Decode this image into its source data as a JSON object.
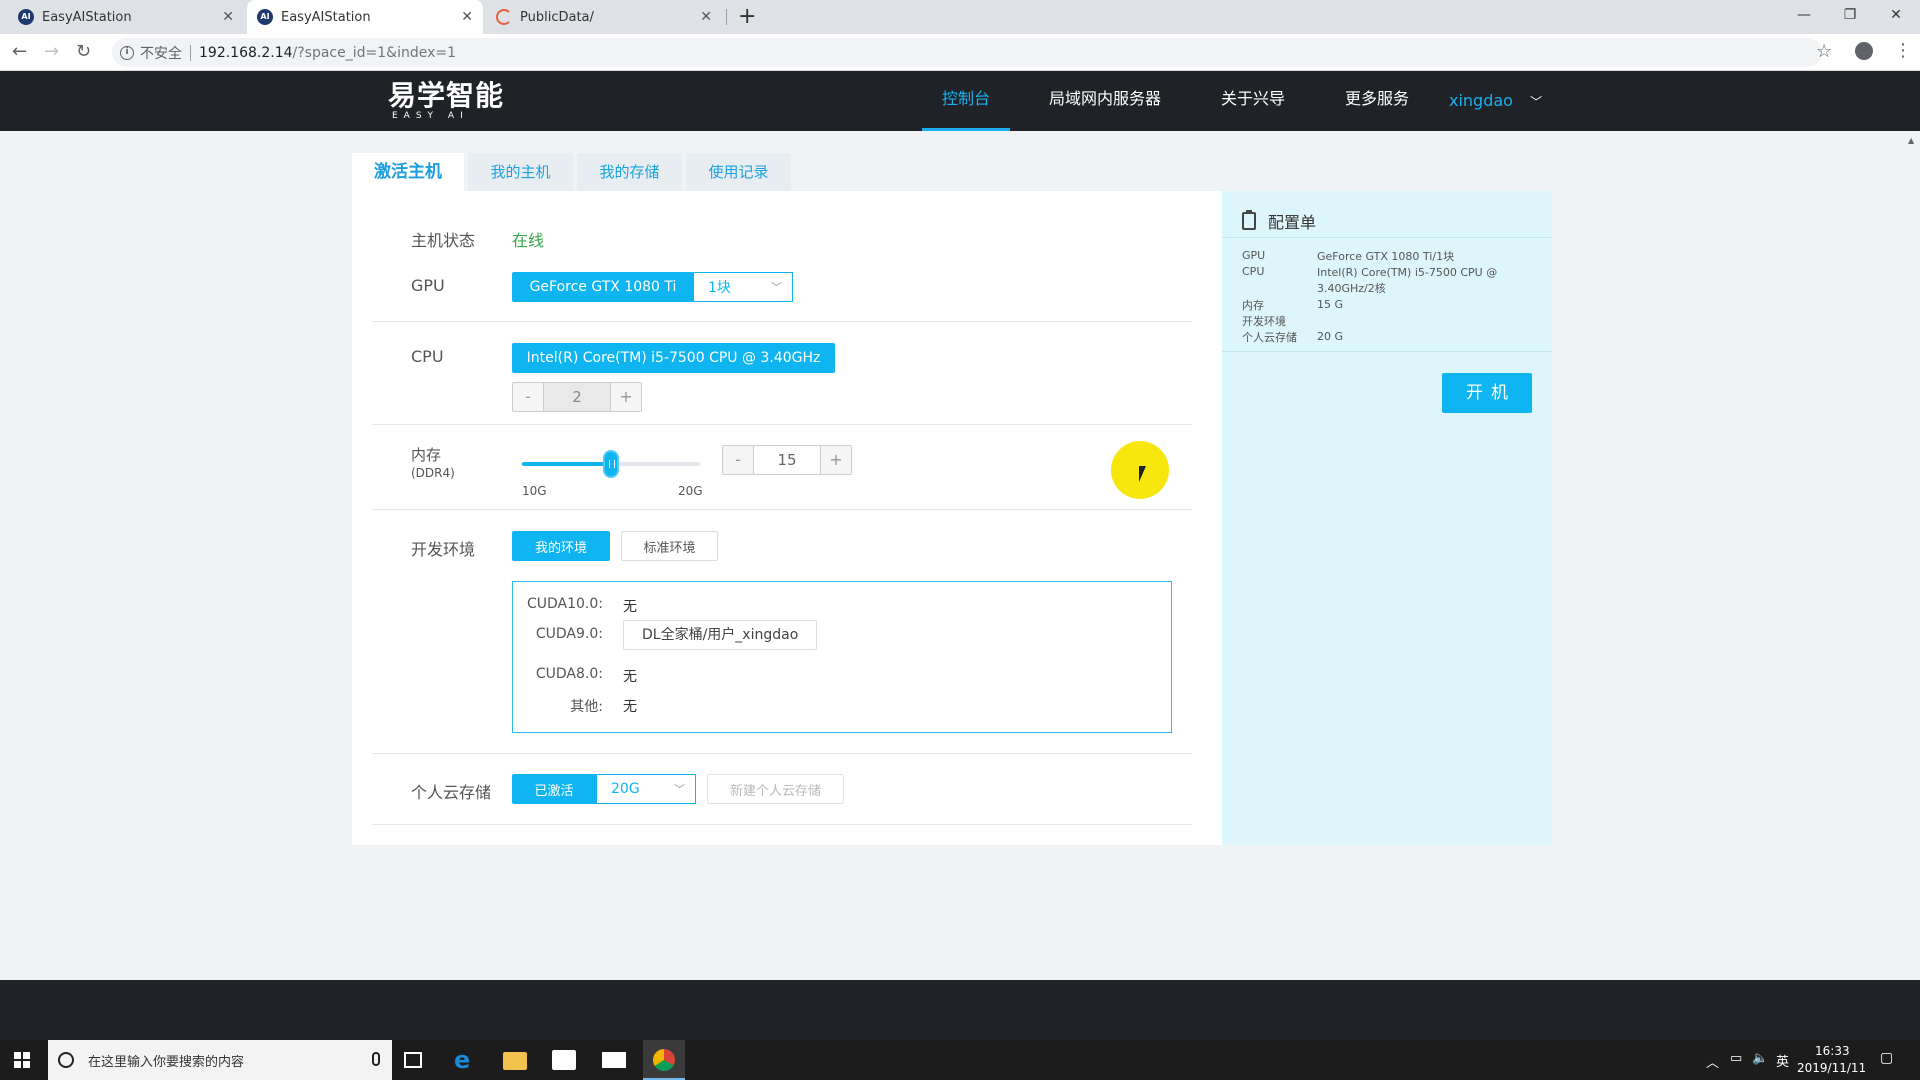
{
  "browser": {
    "tabs": [
      {
        "title": "EasyAIStation",
        "favicon": "AI"
      },
      {
        "title": "EasyAIStation",
        "favicon": "AI"
      },
      {
        "title": "PublicData/",
        "favicon": ""
      }
    ],
    "insecure_label": "不安全",
    "url_host": "192.168.2.14",
    "url_path": "/?space_id=1&index=1"
  },
  "header": {
    "logo_text": "易学智能",
    "logo_sub": "EASY AI",
    "nav": [
      "控制台",
      "局域网内服务器",
      "关于兴导",
      "更多服务"
    ],
    "user": "xingdao"
  },
  "page_tabs": [
    "激活主机",
    "我的主机",
    "我的存储",
    "使用记录"
  ],
  "form": {
    "status_label": "主机状态",
    "status_value": "在线",
    "gpu_label": "GPU",
    "gpu_model": "GeForce GTX 1080 Ti",
    "gpu_count": "1块",
    "cpu_label": "CPU",
    "cpu_model": "Intel(R) Core(TM) i5-7500 CPU @ 3.40GHz",
    "cpu_minus": "-",
    "cpu_count": "2",
    "cpu_plus": "+",
    "mem_label": "内存",
    "mem_sub": "(DDR4)",
    "mem_min": "10G",
    "mem_max": "20G",
    "mem_level_fraction": 0.5,
    "mem_minus": "-",
    "mem_value": "15",
    "mem_plus": "+",
    "env_label": "开发环境",
    "env_mine": "我的环境",
    "env_standard": "标准环境",
    "env_items": [
      {
        "key": "CUDA10.0:",
        "value": "无"
      },
      {
        "key": "CUDA9.0:",
        "value": "DL全家桶/用户_xingdao"
      },
      {
        "key": "CUDA8.0:",
        "value": "无"
      },
      {
        "key": "其他:",
        "value": "无"
      }
    ],
    "storage_label": "个人云存储",
    "storage_status": "已激活",
    "storage_size": "20G",
    "storage_new": "新建个人云存储"
  },
  "config": {
    "title": "配置单",
    "rows": [
      {
        "key": "GPU",
        "value": "GeForce GTX 1080 Ti/1块"
      },
      {
        "key": "CPU",
        "value": "Intel(R) Core(TM) i5-7500 CPU @ 3.40GHz/2核"
      },
      {
        "key": "内存",
        "value": "15 G"
      },
      {
        "key": "开发环境",
        "value": ""
      },
      {
        "key": "个人云存储",
        "value": "20 G"
      }
    ],
    "power_button": "开机"
  },
  "taskbar": {
    "search_placeholder": "在这里输入你要搜索的内容",
    "ime": "英",
    "time": "16:33",
    "date": "2019/11/11"
  },
  "colors": {
    "accent": "#0fb5f0",
    "header_bg": "#1f2328",
    "online": "#3aa84a",
    "config_bg": "#ddf6fc"
  }
}
